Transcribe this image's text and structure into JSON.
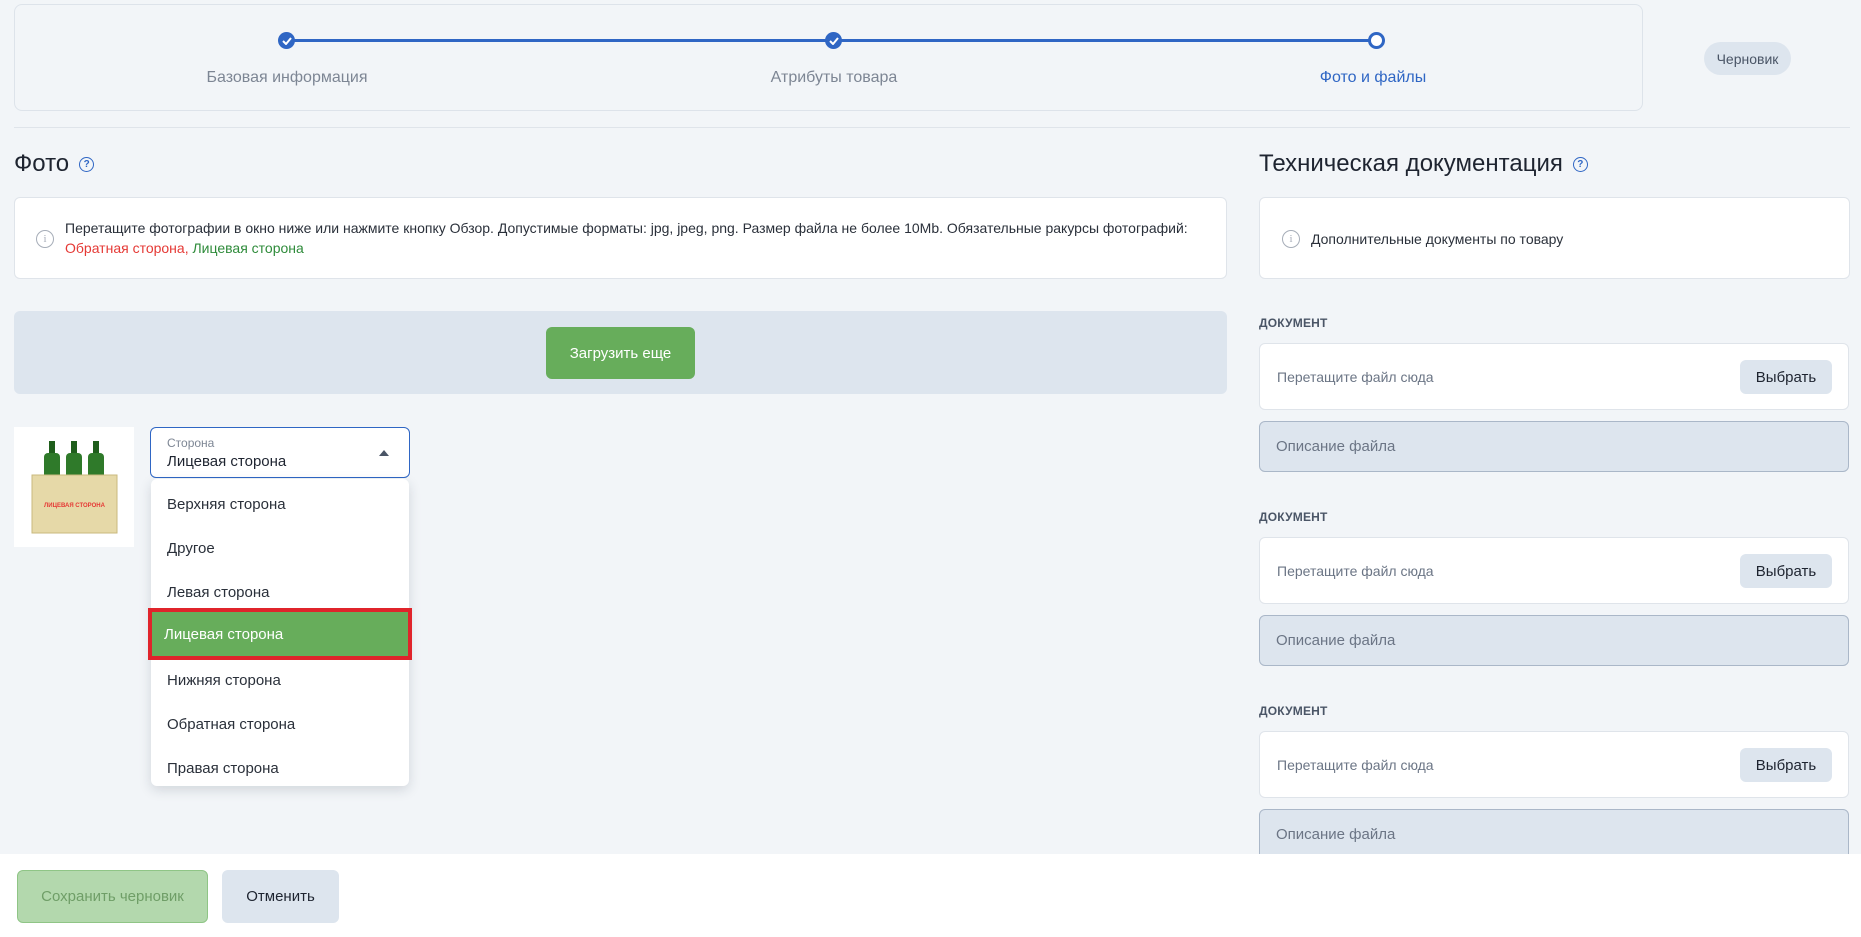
{
  "stepper": {
    "steps": [
      {
        "label": "Базовая информация",
        "state": "done"
      },
      {
        "label": "Атрибуты товара",
        "state": "done"
      },
      {
        "label": "Фото и файлы",
        "state": "current"
      }
    ],
    "status_badge": "Черновик"
  },
  "photo": {
    "title": "Фото",
    "hint_text": "Перетащите фотографии в окно ниже или нажмите кнопку Обзор. Допустимые форматы: jpg, jpeg, png. Размер файла не более 10Mb. Обязательные ракурсы фотографий:",
    "required_back": "Обратная сторона,",
    "required_front": "Лицевая сторона",
    "upload_more_label": "Загрузить еще",
    "thumbnail_caption": "ЛИЦЕВАЯ СТОРОНА",
    "side_select": {
      "label": "Сторона",
      "value": "Лицевая сторона",
      "options": [
        "Верхняя сторона",
        "Другое",
        "Левая сторона",
        "Лицевая сторона",
        "Нижняя сторона",
        "Обратная сторона",
        "Правая сторона"
      ],
      "highlighted_index": 3
    }
  },
  "tech_docs": {
    "title": "Техническая документация",
    "hint_text": "Дополнительные документы по товару",
    "documents": [
      {
        "label": "ДОКУМЕНТ",
        "drop_placeholder": "Перетащите файл сюда",
        "choose_label": "Выбрать",
        "description_placeholder": "Описание файла"
      },
      {
        "label": "ДОКУМЕНТ",
        "drop_placeholder": "Перетащите файл сюда",
        "choose_label": "Выбрать",
        "description_placeholder": "Описание файла"
      },
      {
        "label": "ДОКУМЕНТ",
        "drop_placeholder": "Перетащите файл сюда",
        "choose_label": "Выбрать",
        "description_placeholder": "Описание файла"
      }
    ]
  },
  "footer": {
    "save_draft_label": "Сохранить черновик",
    "cancel_label": "Отменить"
  },
  "colors": {
    "accent_blue": "#2f66c4",
    "brand_green": "#67ad5b",
    "highlight_red": "#e0242b"
  }
}
